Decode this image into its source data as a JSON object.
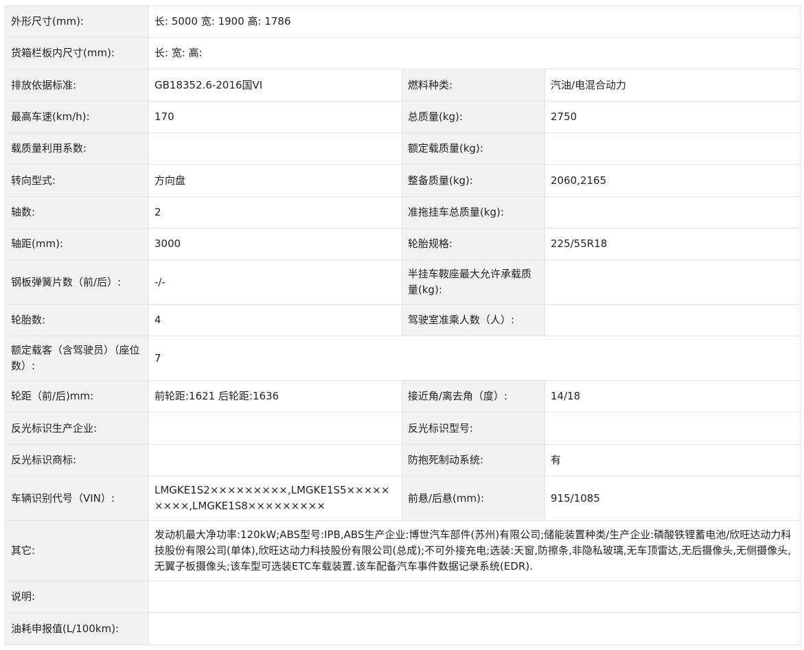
{
  "rows": [
    {
      "type": "full",
      "label": "外形尺寸(mm):",
      "value": "长: 5000 宽: 1900 高: 1786"
    },
    {
      "type": "full",
      "label": "货箱栏板内尺寸(mm):",
      "value": "长: 宽: 高:"
    },
    {
      "type": "pair",
      "label1": "排放依据标准:",
      "value1": "GB18352.6-2016国VI",
      "label2": "燃料种类:",
      "value2": "汽油/电混合动力"
    },
    {
      "type": "pair",
      "label1": "最高车速(km/h):",
      "value1": "170",
      "label2": "总质量(kg):",
      "value2": "2750"
    },
    {
      "type": "pair",
      "label1": "载质量利用系数:",
      "value1": "",
      "label2": "额定载质量(kg):",
      "value2": ""
    },
    {
      "type": "pair",
      "label1": "转向型式:",
      "value1": "方向盘",
      "label2": "整备质量(kg):",
      "value2": "2060,2165"
    },
    {
      "type": "pair",
      "label1": "轴数:",
      "value1": "2",
      "label2": "准拖挂车总质量(kg):",
      "value2": ""
    },
    {
      "type": "pair",
      "label1": "轴距(mm):",
      "value1": "3000",
      "label2": "轮胎规格:",
      "value2": "225/55R18"
    },
    {
      "type": "pair",
      "label1": "钢板弹簧片数（前/后）:",
      "value1": "-/-",
      "label2": "半挂车鞍座最大允许承载质量(kg):",
      "value2": ""
    },
    {
      "type": "pair",
      "label1": "轮胎数:",
      "value1": "4",
      "label2": "驾驶室准乘人数（人）:",
      "value2": ""
    },
    {
      "type": "full",
      "label": "额定载客（含驾驶员）（座位数）:",
      "value": "7"
    },
    {
      "type": "pair",
      "label1": "轮距（前/后)mm:",
      "value1": "前轮距:1621 后轮距:1636",
      "label2": "接近角/离去角（度）:",
      "value2": "14/18"
    },
    {
      "type": "pair",
      "label1": "反光标识生产企业:",
      "value1": "",
      "label2": "反光标识型号:",
      "value2": ""
    },
    {
      "type": "pair",
      "label1": "反光标识商标:",
      "value1": "",
      "label2": "防抱死制动系统:",
      "value2": "有"
    },
    {
      "type": "pair",
      "label1": "车辆识别代号（VIN）:",
      "value1": "LMGKE1S2×××××××××,LMGKE1S5×××××××××,LMGKE1S8×××××××××",
      "label2": "前悬/后悬(mm):",
      "value2": "915/1085"
    },
    {
      "type": "full",
      "label": "其它:",
      "value": "发动机最大净功率:120kW;ABS型号:IPB,ABS生产企业:博世汽车部件(苏州)有限公司;储能装置种类/生产企业:磷酸铁锂蓄电池/欣旺达动力科技股份有限公司(单体),欣旺达动力科技股份有限公司(总成);不可外接充电;选装:天窗,防擦条,非隐私玻璃,无车顶雷达,无后摄像头,无侧摄像头,无翼子板摄像头;该车型可选装ETC车载装置.该车配备汽车事件数据记录系统(EDR)."
    },
    {
      "type": "full",
      "label": "说明:",
      "value": ""
    },
    {
      "type": "full",
      "label": "油耗申报值(L/100km):",
      "value": ""
    }
  ]
}
